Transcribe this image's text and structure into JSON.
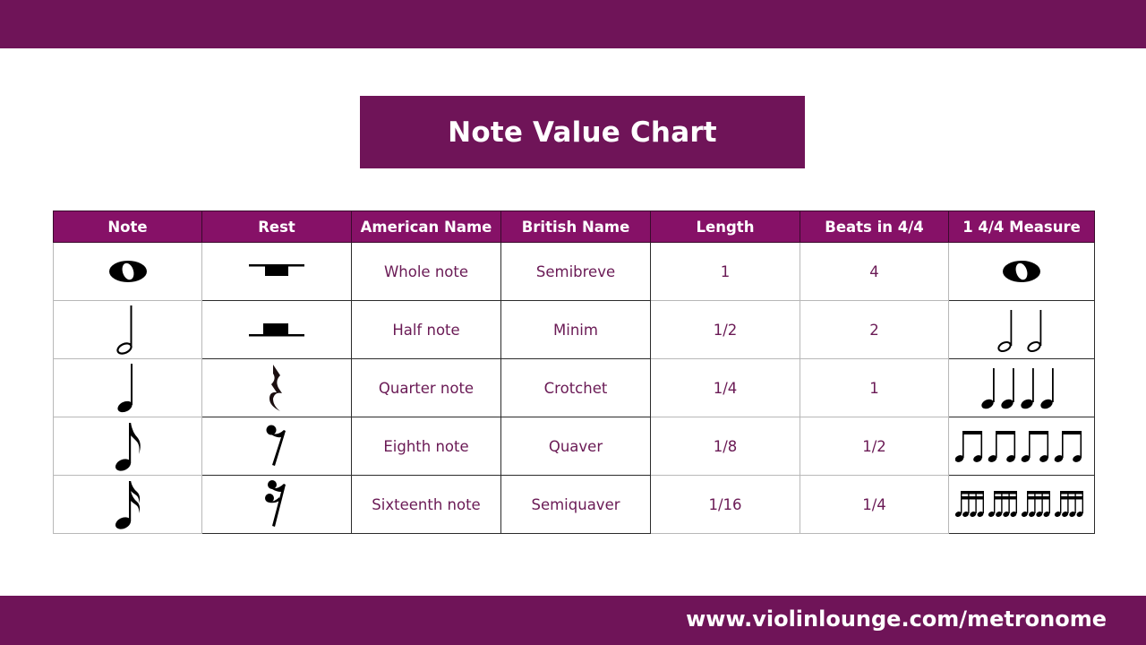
{
  "page": {
    "title": "Note Value Chart",
    "footer_url": "www.violinlounge.com/metronome",
    "colors": {
      "banner": "#6f1458",
      "header_row": "#861167",
      "cell_text": "#6a1a55",
      "header_text": "#ffffff"
    }
  },
  "table": {
    "headers": [
      "Note",
      "Rest",
      "American Name",
      "British Name",
      "Length",
      "Beats in 4/4",
      "1 4/4 Measure"
    ],
    "rows": [
      {
        "note_icon": "whole-note-icon",
        "rest_icon": "whole-rest-icon",
        "american": "Whole note",
        "british": "Semibreve",
        "length": "1",
        "beats": "4",
        "measure_icon": "one-whole-note-icon",
        "measure_count": 1
      },
      {
        "note_icon": "half-note-icon",
        "rest_icon": "half-rest-icon",
        "american": "Half note",
        "british": "Minim",
        "length": "1/2",
        "beats": "2",
        "measure_icon": "two-half-notes-icon",
        "measure_count": 2
      },
      {
        "note_icon": "quarter-note-icon",
        "rest_icon": "quarter-rest-icon",
        "american": "Quarter note",
        "british": "Crotchet",
        "length": "1/4",
        "beats": "1",
        "measure_icon": "four-quarter-notes-icon",
        "measure_count": 4
      },
      {
        "note_icon": "eighth-note-icon",
        "rest_icon": "eighth-rest-icon",
        "american": "Eighth note",
        "british": "Quaver",
        "length": "1/8",
        "beats": "1/2",
        "measure_icon": "eight-eighth-notes-beamed-icon",
        "measure_count": 8
      },
      {
        "note_icon": "sixteenth-note-icon",
        "rest_icon": "sixteenth-rest-icon",
        "american": "Sixteenth note",
        "british": "Semiquaver",
        "length": "1/16",
        "beats": "1/4",
        "measure_icon": "sixteen-sixteenth-notes-beamed-icon",
        "measure_count": 16
      }
    ]
  }
}
